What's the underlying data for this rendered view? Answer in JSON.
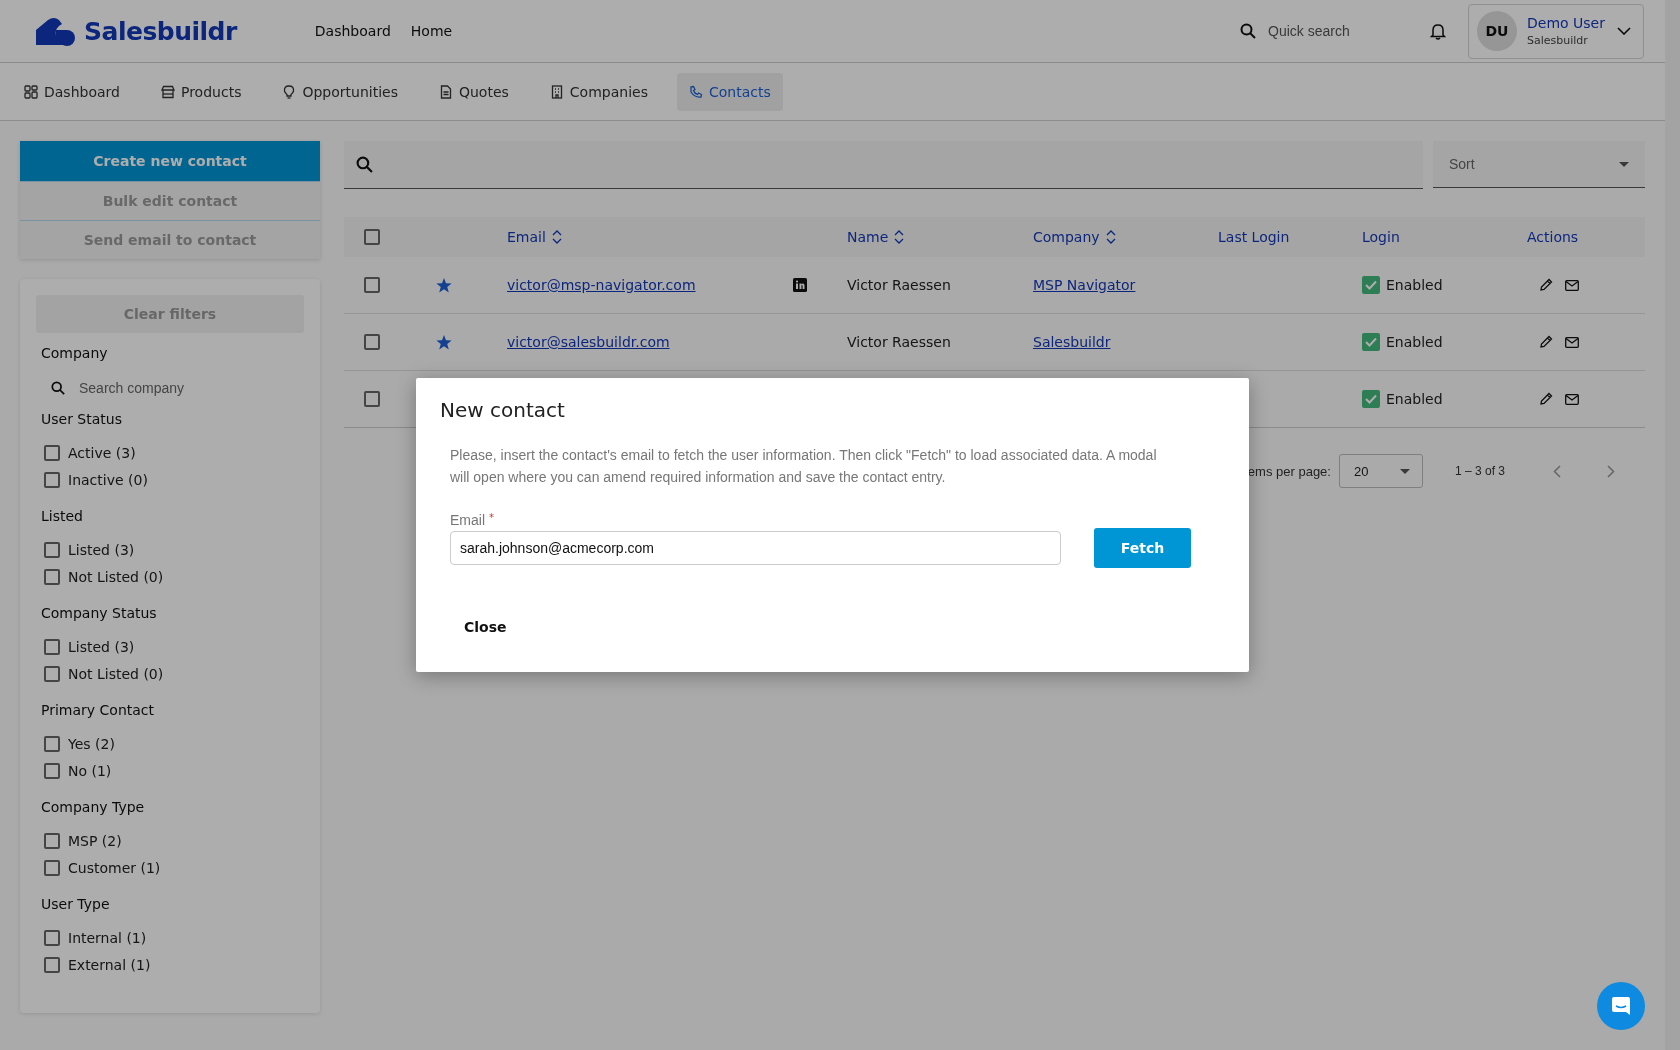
{
  "header": {
    "logo": "Salesbuildr",
    "nav_links": [
      "Dashboard",
      "Home"
    ],
    "quick_search": {
      "placeholder": "Quick search"
    },
    "user": {
      "initials": "DU",
      "name": "Demo User",
      "org": "Salesbuildr"
    }
  },
  "tabs": [
    {
      "label": "Dashboard",
      "selected": false
    },
    {
      "label": "Products",
      "selected": false
    },
    {
      "label": "Opportunities",
      "selected": false
    },
    {
      "label": "Quotes",
      "selected": false
    },
    {
      "label": "Companies",
      "selected": false
    },
    {
      "label": "Contacts",
      "selected": true
    }
  ],
  "actions": [
    {
      "label": "Create new contact",
      "kind": "primary"
    },
    {
      "label": "Bulk edit contact",
      "kind": "secondary"
    },
    {
      "label": "Send email to contact",
      "kind": "secondary"
    }
  ],
  "filters": {
    "clear": "Clear filters",
    "company": {
      "title": "Company",
      "placeholder": "Search company"
    },
    "groups": [
      {
        "title": "User Status",
        "options": [
          {
            "label": "Active (3)",
            "checked": false
          },
          {
            "label": "Inactive (0)",
            "checked": false
          }
        ]
      },
      {
        "title": "Listed",
        "options": [
          {
            "label": "Listed (3)",
            "checked": false
          },
          {
            "label": "Not Listed (0)",
            "checked": false
          }
        ]
      },
      {
        "title": "Company Status",
        "options": [
          {
            "label": "Listed (3)",
            "checked": false
          },
          {
            "label": "Not Listed (0)",
            "checked": false
          }
        ]
      },
      {
        "title": "Primary Contact",
        "options": [
          {
            "label": "Yes (2)",
            "checked": false
          },
          {
            "label": "No (1)",
            "checked": false
          }
        ]
      },
      {
        "title": "Company Type",
        "options": [
          {
            "label": "MSP (2)",
            "checked": false
          },
          {
            "label": "Customer (1)",
            "checked": false
          }
        ]
      },
      {
        "title": "User Type",
        "options": [
          {
            "label": "Internal (1)",
            "checked": false
          },
          {
            "label": "External (1)",
            "checked": false
          }
        ]
      }
    ]
  },
  "table": {
    "sort": {
      "placeholder": "Sort"
    },
    "all_selected": false,
    "columns": [
      {
        "label": "Email",
        "sortable": true
      },
      {
        "label": "Name",
        "sortable": true
      },
      {
        "label": "Company",
        "sortable": true
      },
      {
        "label": "Last Login",
        "sortable": false
      },
      {
        "label": "Login",
        "sortable": false
      },
      {
        "label": "Actions",
        "sortable": false
      }
    ],
    "rows": [
      {
        "selected": false,
        "starred": true,
        "email": "victor@msp-navigator.com",
        "linkedin": true,
        "name": "Victor Raessen",
        "company": "MSP Navigator",
        "login_enabled": true,
        "login": "Enabled"
      },
      {
        "selected": false,
        "starred": true,
        "email": "victor@salesbuildr.com",
        "linkedin": false,
        "name": "Victor Raessen",
        "company": "Salesbuildr",
        "login_enabled": true,
        "login": "Enabled"
      },
      {
        "selected": false,
        "login_enabled": true,
        "login": "Enabled"
      }
    ]
  },
  "pagination": {
    "per_page_label": "ems per page:",
    "per_page": "20",
    "range": "1 – 3 of 3"
  },
  "modal": {
    "title": "New contact",
    "description": "Please, insert the contact's email to fetch the user information. Then click \"Fetch\" to load associated data. A modal will open where you can amend required information and save the contact entry.",
    "email_label": "Email",
    "required_mark": "*",
    "email_value": "sarah.johnson@acmecorp.com",
    "fetch": "Fetch",
    "close": "Close"
  }
}
